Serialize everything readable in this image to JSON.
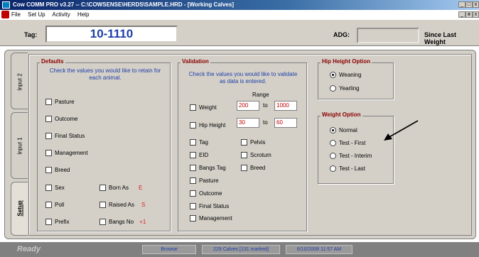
{
  "window": {
    "title": "Cow COMM PRO v3.27 -- C:\\COWSENSE\\HERDS\\SAMPLE.HRD - [Working Calves]"
  },
  "menu": [
    "File",
    "Set Up",
    "Activity",
    "Help"
  ],
  "winbuttons": {
    "min": "_",
    "max": "□",
    "close": "x",
    "restore": "ɵ"
  },
  "header": {
    "tag_label": "Tag:",
    "tag_value": "10-1110",
    "adg_label": "ADG:",
    "adg_value": "",
    "since_label": "Since Last Weight"
  },
  "tabs": [
    "Input 2",
    "Input 1",
    "Setup"
  ],
  "defaults": {
    "title": "Defaults",
    "hint": "Check the values you would like to retain for each animal.",
    "items": [
      "Pasture",
      "Outcome",
      "Final Status",
      "Management",
      "Breed",
      "Sex",
      "Poll",
      "Prefix"
    ],
    "right_items": [
      {
        "label": "Born As",
        "code": "E"
      },
      {
        "label": "Raised As",
        "code": "S"
      },
      {
        "label": "Bangs No",
        "code": "+1"
      }
    ]
  },
  "validation": {
    "title": "Validation",
    "hint": "Check the values you would like to validate as data is entered.",
    "range_label": "Range",
    "to_label": "to",
    "weight": {
      "label": "Weight",
      "min": "200",
      "max": "1000"
    },
    "hip": {
      "label": "Hip Height",
      "min": "30",
      "max": "60"
    },
    "left_items": [
      "Tag",
      "EID",
      "Bangs Tag",
      "Pasture",
      "Outcome",
      "Final Status",
      "Management"
    ],
    "right_items": [
      "Pelvis",
      "Scrotum",
      "Breed"
    ]
  },
  "hip_option": {
    "title": "Hip Height Option",
    "options": [
      "Weaning",
      "Yearling"
    ],
    "selected": "Weaning"
  },
  "weight_option": {
    "title": "Weight Option",
    "options": [
      "Normal",
      "Test - First",
      "Test - Interim",
      "Test - Last"
    ],
    "selected": "Normal"
  },
  "status": {
    "ready": "Ready",
    "mode": "Browse",
    "count": "229 Calves [131 marked]",
    "datetime": "6/10/2008  11:57 AM"
  },
  "colors": {
    "title_bar": "#0a246a",
    "tag_text": "#1f3fa8",
    "group_title": "#8b0000",
    "range_text": "#c00000",
    "code_text": "#e02020"
  }
}
